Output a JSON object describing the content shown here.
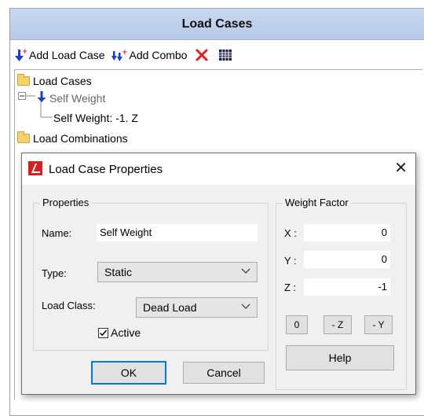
{
  "panel": {
    "title": "Load Cases"
  },
  "toolbar": {
    "add_load_case": "Add Load Case",
    "add_combo": "Add Combo"
  },
  "tree": {
    "root_load_cases": "Load Cases",
    "self_weight": "Self Weight",
    "self_weight_child": "Self Weight: -1. Z",
    "root_load_combinations": "Load Combinations",
    "expander": "−"
  },
  "dialog": {
    "title": "Load Case Properties",
    "close_glyph": "✕",
    "properties": {
      "group_label": "Properties",
      "name_label": "Name:",
      "name_value": "Self Weight",
      "type_label": "Type:",
      "type_value": "Static",
      "load_class_label": "Load Class:",
      "load_class_value": "Dead Load",
      "active_label": "Active",
      "active_checked": true
    },
    "weight_factor": {
      "group_label": "Weight Factor",
      "x_label": "X :",
      "x_value": "0",
      "y_label": "Y :",
      "y_value": "0",
      "z_label": "Z :",
      "z_value": "-1",
      "btn_zero": "0",
      "btn_neg_z": "- Z",
      "btn_neg_y": "- Y",
      "help": "Help"
    },
    "ok": "OK",
    "cancel": "Cancel"
  },
  "colors": {
    "header_bg": "#b5c9e8",
    "load_arrow": "#1a3fc4",
    "delete_x": "#e02020",
    "app_icon": "#d42020",
    "default_button_border": "#0078d7"
  },
  "icons": [
    "add-load-case-icon",
    "add-combo-icon",
    "delete-icon",
    "table-icon",
    "folder-icon",
    "load-arrow-icon",
    "app-logo-icon",
    "close-icon",
    "chevron-down-icon",
    "checkmark-icon"
  ]
}
